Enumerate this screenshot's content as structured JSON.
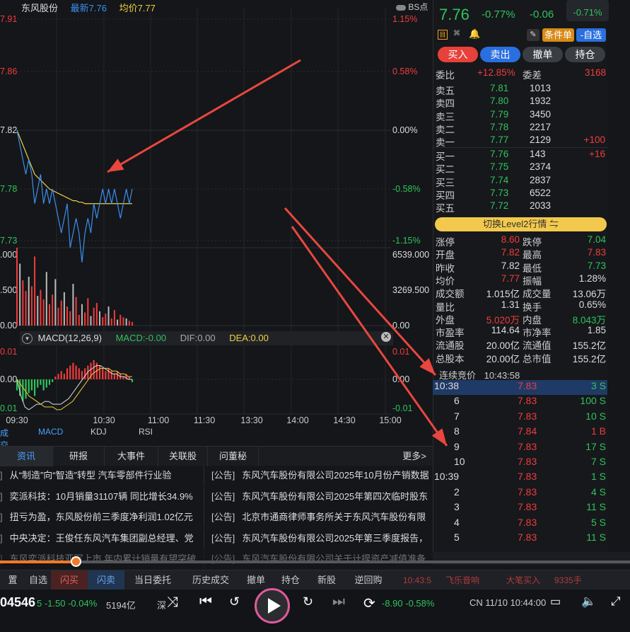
{
  "header": {
    "stock": "东风股份",
    "latest_label": "最新7.76",
    "avg_label": "均价7.77",
    "bs": "BS点"
  },
  "price_axis_left": [
    "7.91",
    "7.86",
    "7.82",
    "7.78",
    "7.73"
  ],
  "price_axis_right": [
    "1.15%",
    "0.58%",
    "0.00%",
    "-0.58%",
    "-1.15%"
  ],
  "vol_axis_left": [
    ".000",
    ".500",
    "0.00"
  ],
  "vol_axis_right": [
    "6539.000",
    "3269.500",
    "0.00"
  ],
  "macd": {
    "title": "MACD(12,26,9)",
    "macd": "MACD:-0.00",
    "dif": "DIF:0.00",
    "dea": "DEA:0.00",
    "left": [
      "0.01",
      "0.00",
      "0.01"
    ],
    "right": [
      "0.01",
      "0.00",
      "-0.01"
    ]
  },
  "time_axis": [
    "09:30",
    "10:30",
    "11:00",
    "11:30",
    "13:30",
    "14:00",
    "14:30",
    "15:00"
  ],
  "indicator_tabs": [
    "成交量",
    "MACD",
    "KDJ",
    "RSI"
  ],
  "quote": {
    "price": "7.76",
    "pct": "-0.77%",
    "chg": "-0.06",
    "index_pct": "-0.71%"
  },
  "tools": {
    "cond": "条件单",
    "fav": "-自选"
  },
  "actions": [
    "买入",
    "卖出",
    "撤单",
    "持仓"
  ],
  "weibi": {
    "label": "委比",
    "value": "+12.85%",
    "diff_label": "委差",
    "diff": "3168"
  },
  "asks": [
    {
      "l": "卖五",
      "p": "7.81",
      "v": "1013",
      "x": ""
    },
    {
      "l": "卖四",
      "p": "7.80",
      "v": "1932",
      "x": ""
    },
    {
      "l": "卖三",
      "p": "7.79",
      "v": "3450",
      "x": ""
    },
    {
      "l": "卖二",
      "p": "7.78",
      "v": "2217",
      "x": ""
    },
    {
      "l": "卖一",
      "p": "7.77",
      "v": "2129",
      "x": "+100"
    }
  ],
  "bids": [
    {
      "l": "买一",
      "p": "7.76",
      "v": "143",
      "x": "+16"
    },
    {
      "l": "买二",
      "p": "7.75",
      "v": "2374",
      "x": ""
    },
    {
      "l": "买三",
      "p": "7.74",
      "v": "2837",
      "x": ""
    },
    {
      "l": "买四",
      "p": "7.73",
      "v": "6522",
      "x": ""
    },
    {
      "l": "买五",
      "p": "7.72",
      "v": "2033",
      "x": ""
    }
  ],
  "level2": "切换Level2行情 ⇋",
  "stats": [
    [
      "涨停",
      "8.60",
      "跌停",
      "7.04"
    ],
    [
      "开盘",
      "7.82",
      "最高",
      "7.83"
    ],
    [
      "昨收",
      "7.82",
      "最低",
      "7.73"
    ],
    [
      "均价",
      "7.77",
      "振幅",
      "1.28%"
    ],
    [
      "成交额",
      "1.015亿",
      "成交量",
      "13.06万"
    ],
    [
      "量比",
      "1.31",
      "换手",
      "0.65%"
    ],
    [
      "外盘",
      "5.020万",
      "内盘",
      "8.043万"
    ],
    [
      "市盈率",
      "114.64",
      "市净率",
      "1.85"
    ],
    [
      "流通股",
      "20.00亿",
      "流通值",
      "155.2亿"
    ],
    [
      "总股本",
      "20.00亿",
      "总市值",
      "155.2亿"
    ]
  ],
  "auction": {
    "label": "连续竞价",
    "time": "10:43:58"
  },
  "trades": [
    {
      "t": "10:38",
      "p": "7.83",
      "v": "3 S"
    },
    {
      "t": "6",
      "p": "7.83",
      "v": "100 S"
    },
    {
      "t": "7",
      "p": "7.83",
      "v": "10 S"
    },
    {
      "t": "8",
      "p": "7.84",
      "v": "1 B"
    },
    {
      "t": "9",
      "p": "7.83",
      "v": "17 S"
    },
    {
      "t": "10",
      "p": "7.83",
      "v": "7 S"
    },
    {
      "t": "10:39",
      "p": "7.83",
      "v": "1 S"
    },
    {
      "t": "2",
      "p": "7.83",
      "v": "4 S"
    },
    {
      "t": "3",
      "p": "7.83",
      "v": "11 S"
    },
    {
      "t": "4",
      "p": "7.83",
      "v": "5 S"
    },
    {
      "t": "5",
      "p": "7.83",
      "v": "11 S"
    }
  ],
  "news_tabs": [
    "资讯",
    "研报",
    "大事件",
    "关联股",
    "问董秘",
    "更多>"
  ],
  "news_left": [
    "从“制造”向“智造”转型 汽车零部件行业验",
    "奕派科技：10月销量31107辆 同比增长34.9%",
    "扭亏为盈，东风股份前三季度净利润1.02亿元",
    "中央决定：王俊任东风汽车集团副总经理、党",
    "东风奕派科技亚军上市 年内累计销量有望突破"
  ],
  "news_right": [
    [
      "[公告]",
      "东风汽车股份有限公司2025年10月份产销数据"
    ],
    [
      "[公告]",
      "东风汽车股份有限公司2025年第四次临时股东"
    ],
    [
      "[公告]",
      "北京市通商律师事务所关于东风汽车股份有限"
    ],
    [
      "[公告]",
      "东风汽车股份有限公司2025年第三季度报告，"
    ],
    [
      "[公告]",
      "东风汽车股份有限公司关于计提资产减值准备"
    ]
  ],
  "bottom_tabs": [
    "置",
    "自选",
    "闪买",
    "闪卖",
    "当日委托",
    "历史成交",
    "撤单",
    "持仓",
    "新股",
    "逆回购"
  ],
  "bottom_right": {
    "time": "10:43:5",
    "text": "飞乐音响",
    "big": "大笔买入",
    "vol": "9335手"
  },
  "status": {
    "code": "04546",
    "s1": "5  -1.50  -0.04%",
    "s2": "5194亿",
    "s3": "深",
    "s4": "-8.90 -0.58%",
    "clock": "CN 11/10 10:44:00"
  },
  "progress": 0.12,
  "colors": {
    "red": "#f03c3c",
    "green": "#2fc35c",
    "buy": "#e8403a",
    "sell": "#2a6fe0",
    "yellow": "#f0d040",
    "blue": "#3b8ff0"
  }
}
